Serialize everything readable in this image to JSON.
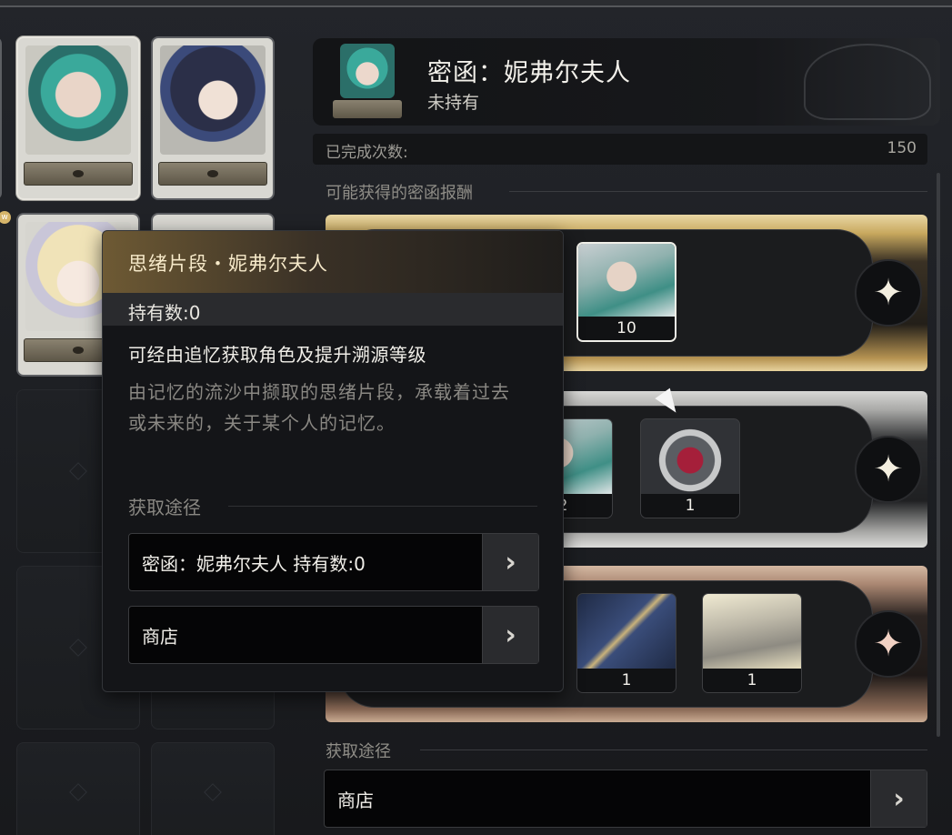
{
  "header": {
    "title": "密函：妮弗尔夫人",
    "status": "未持有"
  },
  "stats": {
    "completed_label": "已完成次数:",
    "completed_value": "150"
  },
  "rewards": {
    "section_label": "可能获得的密函报酬",
    "tiers": [
      {
        "tier": "gold",
        "items": [
          {
            "name": "character-fragment",
            "count": "10"
          }
        ]
      },
      {
        "tier": "silver",
        "items": [
          {
            "name": "character-fragment",
            "count": "2"
          },
          {
            "name": "crimson-cube",
            "count": "1"
          }
        ]
      },
      {
        "tier": "bronze",
        "items": [
          {
            "name": "blue-tome",
            "count": "1"
          },
          {
            "name": "banner-relic",
            "count": "1"
          }
        ]
      }
    ]
  },
  "acquire": {
    "section_label": "获取途径",
    "shop_label": "商店",
    "arrow": "›"
  },
  "tooltip": {
    "title": "思绪片段・妮弗尔夫人",
    "owned": "持有数:0",
    "desc": "可经由追忆获取角色及提升溯源等级",
    "flavor": "由记忆的流沙中撷取的思绪片段，承载着过去或未来的，关于某个人的记忆。",
    "source_label": "获取途径",
    "sources": [
      {
        "label": "密函：妮弗尔夫人 持有数:0",
        "arrow": "›"
      },
      {
        "label": "商店",
        "arrow": "›"
      }
    ]
  },
  "left_grid": {
    "new_badge": "w"
  },
  "colors": {
    "gold_tier": "#c8a85e",
    "silver_tier": "#a9a9a7",
    "bronze_tier": "#a98671",
    "tooltip_header": "#6e5a34"
  }
}
